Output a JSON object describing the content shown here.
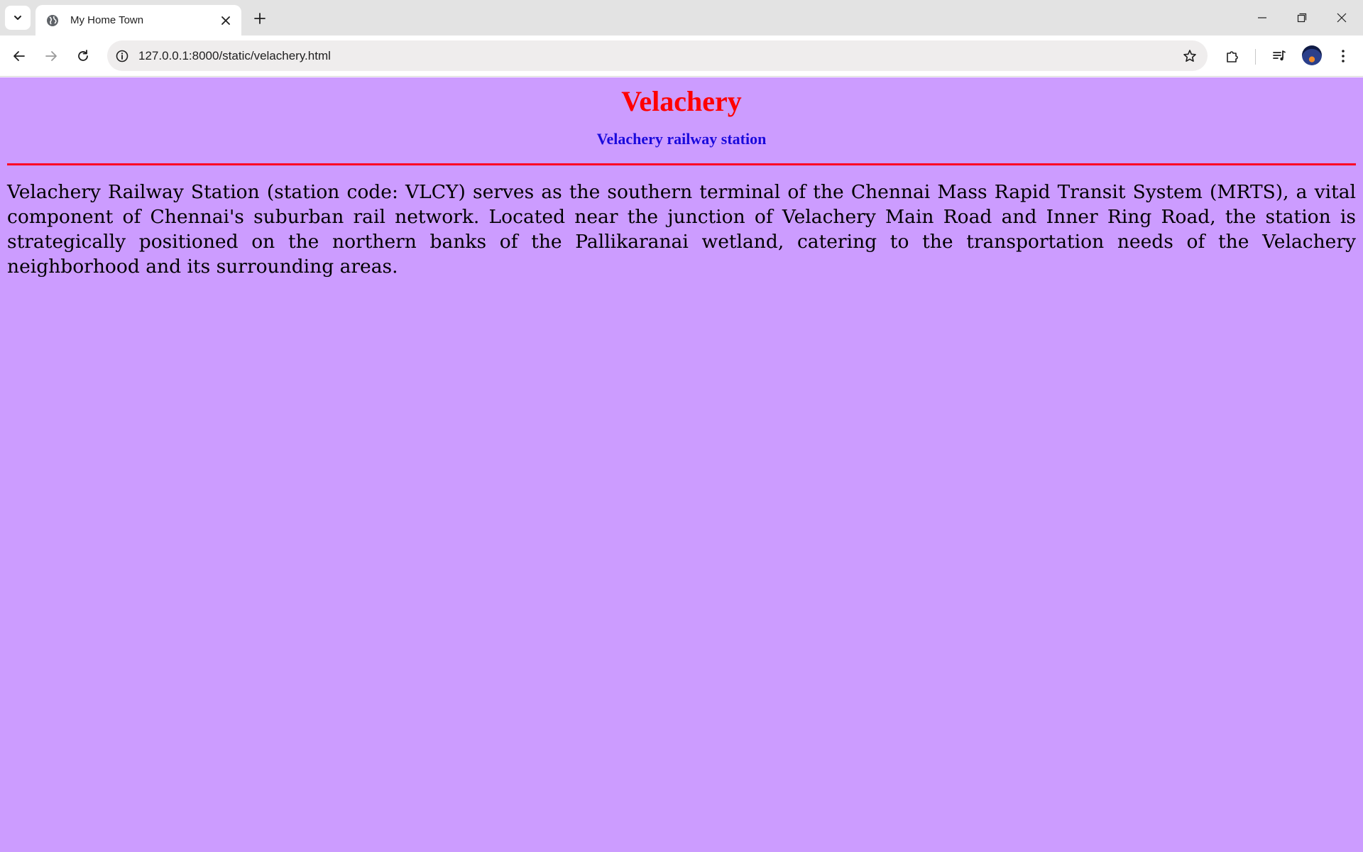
{
  "browser": {
    "tab": {
      "title": "My Home Town",
      "favicon_icon": "globe-icon"
    },
    "address_bar": {
      "url": "127.0.0.1:8000/static/velachery.html"
    },
    "icons": {
      "tab_search": "chevron-down-icon",
      "tab_close": "close-icon",
      "new_tab": "plus-icon",
      "back": "arrow-left-icon",
      "forward": "arrow-right-icon",
      "reload": "reload-icon",
      "site_info": "info-icon",
      "bookmark": "star-icon",
      "extensions": "puzzle-icon",
      "media": "media-queue-icon",
      "menu": "kebab-menu-icon",
      "minimize": "minimize-icon",
      "restore": "restore-icon",
      "close_window": "close-icon"
    }
  },
  "page": {
    "title": "Velachery",
    "subtitle": "Velachery railway station",
    "paragraph": "Velachery Railway Station (station code: VLCY) serves as the southern terminal of the Chennai Mass Rapid Transit System (MRTS), a vital component of Chennai's suburban rail network. Located near the junction of Velachery Main Road and Inner Ring Road, the station is strategically positioned on the northern banks of the Pallikaranai wetland, catering to the transportation needs of the Velachery neighborhood and its surrounding areas."
  },
  "colors": {
    "page_background": "#cc9cff",
    "title": "#ff0000",
    "subtitle": "#1a0adc",
    "rule": "#ff0024",
    "tabstrip": "#e3e3e3",
    "omnibox": "#efeded"
  }
}
